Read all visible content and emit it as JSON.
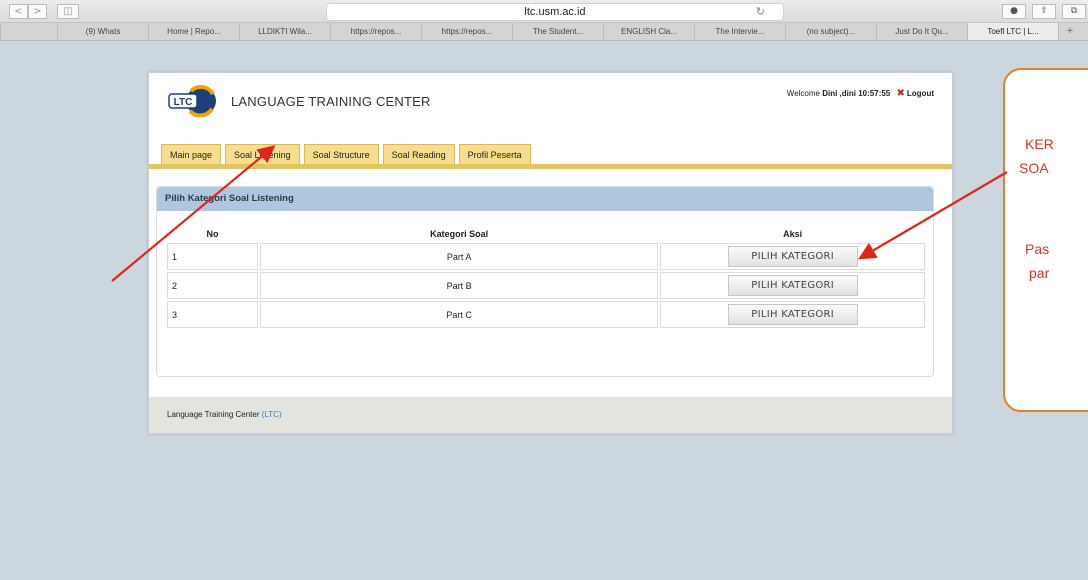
{
  "browser": {
    "url": "ltc.usm.ac.id",
    "nav_back": "<",
    "nav_forward": ">",
    "tabs": [
      {
        "label": "(9) Whats",
        "active": false
      },
      {
        "label": "Home | Repo...",
        "active": false
      },
      {
        "label": "LLDIKTI Wila...",
        "active": false
      },
      {
        "label": "https://repos...",
        "active": false
      },
      {
        "label": "https://repos...",
        "active": false
      },
      {
        "label": "The Student...",
        "active": false
      },
      {
        "label": "ENGLISH Cla...",
        "active": false
      },
      {
        "label": "The Intervie...",
        "active": false
      },
      {
        "label": "(no subject)...",
        "active": false
      },
      {
        "label": "Just Do It Qu...",
        "active": false
      },
      {
        "label": "Toefl LTC | L...",
        "active": true
      }
    ]
  },
  "site": {
    "logo_text": "LTC",
    "title": "LANGUAGE TRAINING CENTER",
    "welcome_prefix": "Welcome",
    "user": "Dini ,dini",
    "time": "10:57:55",
    "logout_label": "Logout",
    "nav_tabs": [
      "Main page",
      "Soal Listening",
      "Soal Structure",
      "Soal Reading",
      "Profil Peserta"
    ]
  },
  "panel": {
    "title": "Pilih Kategori Soal Listening",
    "columns": [
      "No",
      "Kategori Soal",
      "Aksi"
    ],
    "rows": [
      {
        "no": "1",
        "kategori": "Part A",
        "button": "PILIH KATEGORI"
      },
      {
        "no": "2",
        "kategori": "Part B",
        "button": "PILIH KATEGORI"
      },
      {
        "no": "3",
        "kategori": "Part C",
        "button": "PILIH KATEGORI"
      }
    ]
  },
  "footer": {
    "text": "Language Training Center",
    "open": "(",
    "ltc": "LTC",
    "close": ")"
  },
  "callout": {
    "line1": "KER",
    "line2": "SOA",
    "line3": "Pas",
    "line4": "par"
  },
  "colors": {
    "annotation_arrow": "#e0251b",
    "callout_border": "#ec7d22",
    "nav_tab_bg": "#f7de8c",
    "panel_header_bg": "#aec7de"
  }
}
